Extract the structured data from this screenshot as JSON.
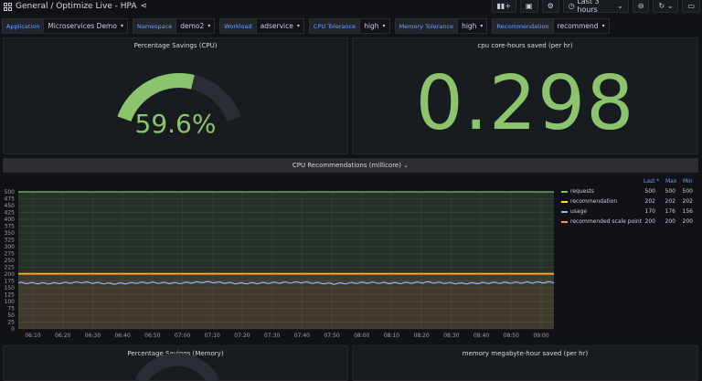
{
  "header": {
    "breadcrumb": "General  /  Optimize Live - HPA",
    "time_range": "Last 3 hours",
    "colors": {
      "accent": "#6e9fff",
      "green": "#8bc46c"
    }
  },
  "variables": [
    {
      "label": "Application",
      "value": "Microservices Demo"
    },
    {
      "label": "Namespace",
      "value": "demo2"
    },
    {
      "label": "Workload",
      "value": "adservice"
    },
    {
      "label": "CPU Tolerance",
      "value": "high"
    },
    {
      "label": "Memory Tolerance",
      "value": "high"
    },
    {
      "label": "Recommendation",
      "value": "recommend"
    }
  ],
  "panels": {
    "gauge_title": "Percentage Savings (CPU)",
    "gauge_value": "59.6%",
    "gauge_fraction": 0.596,
    "stat_title": "cpu core-hours saved (per hr)",
    "stat_value": "0.298",
    "row_title": "CPU Recommendations (millicore)",
    "mem_gauge_title": "Percentage Savings (Memory)",
    "mem_stat_title": "memory megabyte-hour saved (per hr)"
  },
  "legend": {
    "headers": {
      "last": "Last *",
      "max": "Max",
      "min": "Min"
    },
    "items": [
      {
        "name": "requests",
        "color": "#73bf69",
        "last": "500",
        "max": "500",
        "min": "500"
      },
      {
        "name": "recommendation",
        "color": "#fade2a",
        "last": "202",
        "max": "202",
        "min": "202"
      },
      {
        "name": "usage",
        "color": "#8ab8ff",
        "last": "170",
        "max": "176",
        "min": "156"
      },
      {
        "name": "recommended scale point",
        "color": "#ff9830",
        "last": "200",
        "max": "200",
        "min": "200"
      }
    ]
  },
  "chart_data": {
    "type": "line",
    "title": "CPU Recommendations (millicore)",
    "x": [
      "06:10",
      "06:20",
      "06:30",
      "06:40",
      "06:50",
      "07:00",
      "07:10",
      "07:20",
      "07:30",
      "07:40",
      "07:50",
      "08:00",
      "08:10",
      "08:20",
      "08:30",
      "08:40",
      "08:50",
      "09:00"
    ],
    "ylim": [
      0,
      500
    ],
    "yticks": [
      0,
      25,
      50,
      75,
      100,
      125,
      150,
      175,
      200,
      225,
      250,
      275,
      300,
      325,
      350,
      375,
      400,
      425,
      450,
      475,
      500
    ],
    "series": [
      {
        "name": "requests",
        "values": [
          500,
          500,
          500,
          500,
          500,
          500,
          500,
          500,
          500,
          500,
          500,
          500,
          500,
          500,
          500,
          500,
          500,
          500
        ]
      },
      {
        "name": "recommendation",
        "values": [
          202,
          202,
          202,
          202,
          202,
          202,
          202,
          202,
          202,
          202,
          202,
          202,
          202,
          202,
          202,
          202,
          202,
          202
        ]
      },
      {
        "name": "usage",
        "values": [
          168,
          166,
          170,
          165,
          169,
          167,
          171,
          166,
          168,
          170,
          165,
          169,
          167,
          170,
          166,
          168,
          169,
          170
        ]
      },
      {
        "name": "recommended scale point",
        "values": [
          200,
          200,
          200,
          200,
          200,
          200,
          200,
          200,
          200,
          200,
          200,
          200,
          200,
          200,
          200,
          200,
          200,
          200
        ]
      }
    ]
  }
}
